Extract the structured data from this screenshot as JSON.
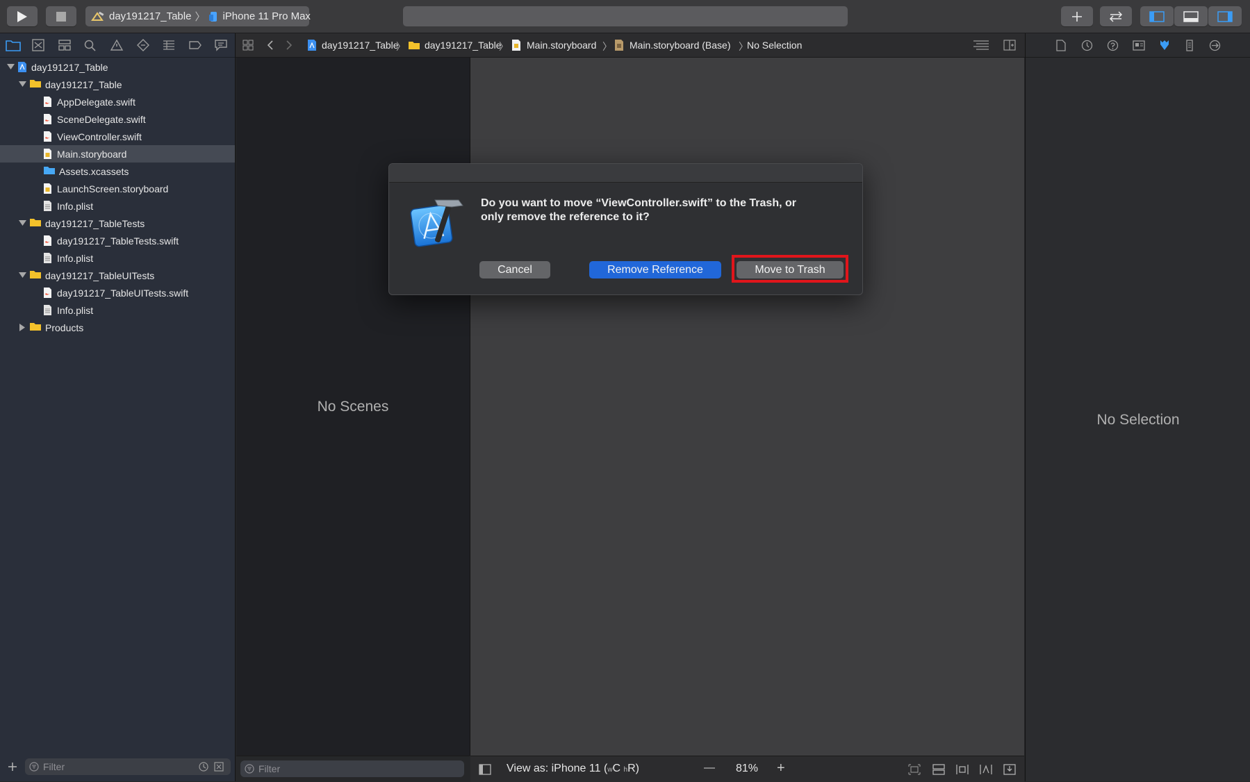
{
  "toolbar": {
    "scheme_name": "day191217_Table",
    "device_name": "iPhone 11 Pro Max",
    "run_icon": "play-icon",
    "stop_icon": "stop-icon"
  },
  "navigator": {
    "items": [
      {
        "label": "day191217_Table",
        "kind": "project"
      },
      {
        "label": "day191217_Table",
        "kind": "folder"
      },
      {
        "label": "AppDelegate.swift",
        "kind": "swift"
      },
      {
        "label": "SceneDelegate.swift",
        "kind": "swift"
      },
      {
        "label": "ViewController.swift",
        "kind": "swift"
      },
      {
        "label": "Main.storyboard",
        "kind": "storyboard"
      },
      {
        "label": "Assets.xcassets",
        "kind": "assets"
      },
      {
        "label": "LaunchScreen.storyboard",
        "kind": "storyboard"
      },
      {
        "label": "Info.plist",
        "kind": "plist"
      },
      {
        "label": "day191217_TableTests",
        "kind": "folder"
      },
      {
        "label": "day191217_TableTests.swift",
        "kind": "swift"
      },
      {
        "label": "Info.plist",
        "kind": "plist"
      },
      {
        "label": "day191217_TableUITests",
        "kind": "folder"
      },
      {
        "label": "day191217_TableUITests.swift",
        "kind": "swift"
      },
      {
        "label": "Info.plist",
        "kind": "plist"
      },
      {
        "label": "Products",
        "kind": "folder"
      }
    ],
    "filter_placeholder": "Filter"
  },
  "jumpbar": {
    "crumbs": [
      "day191217_Table",
      "day191217_Table",
      "Main.storyboard",
      "Main.storyboard (Base)",
      "No Selection"
    ]
  },
  "outline": {
    "empty_text": "No Scenes",
    "filter_placeholder": "Filter"
  },
  "canvas": {
    "view_as_label": "View as: iPhone 11 (",
    "size_class_w": "w",
    "size_class_c": "C",
    "size_class_h": "h",
    "size_class_r": "R)",
    "zoom": "81%",
    "zoom_out": "—",
    "zoom_in": "+"
  },
  "inspector": {
    "empty_text": "No Selection"
  },
  "dialog": {
    "message_line1": "Do you want to move “ViewController.swift” to the Trash, or",
    "message_line2": "only remove the reference to it?",
    "cancel_label": "Cancel",
    "remove_reference_label": "Remove Reference",
    "move_to_trash_label": "Move to Trash",
    "highlight_color": "#e0151b",
    "primary_color": "#2167d9"
  }
}
